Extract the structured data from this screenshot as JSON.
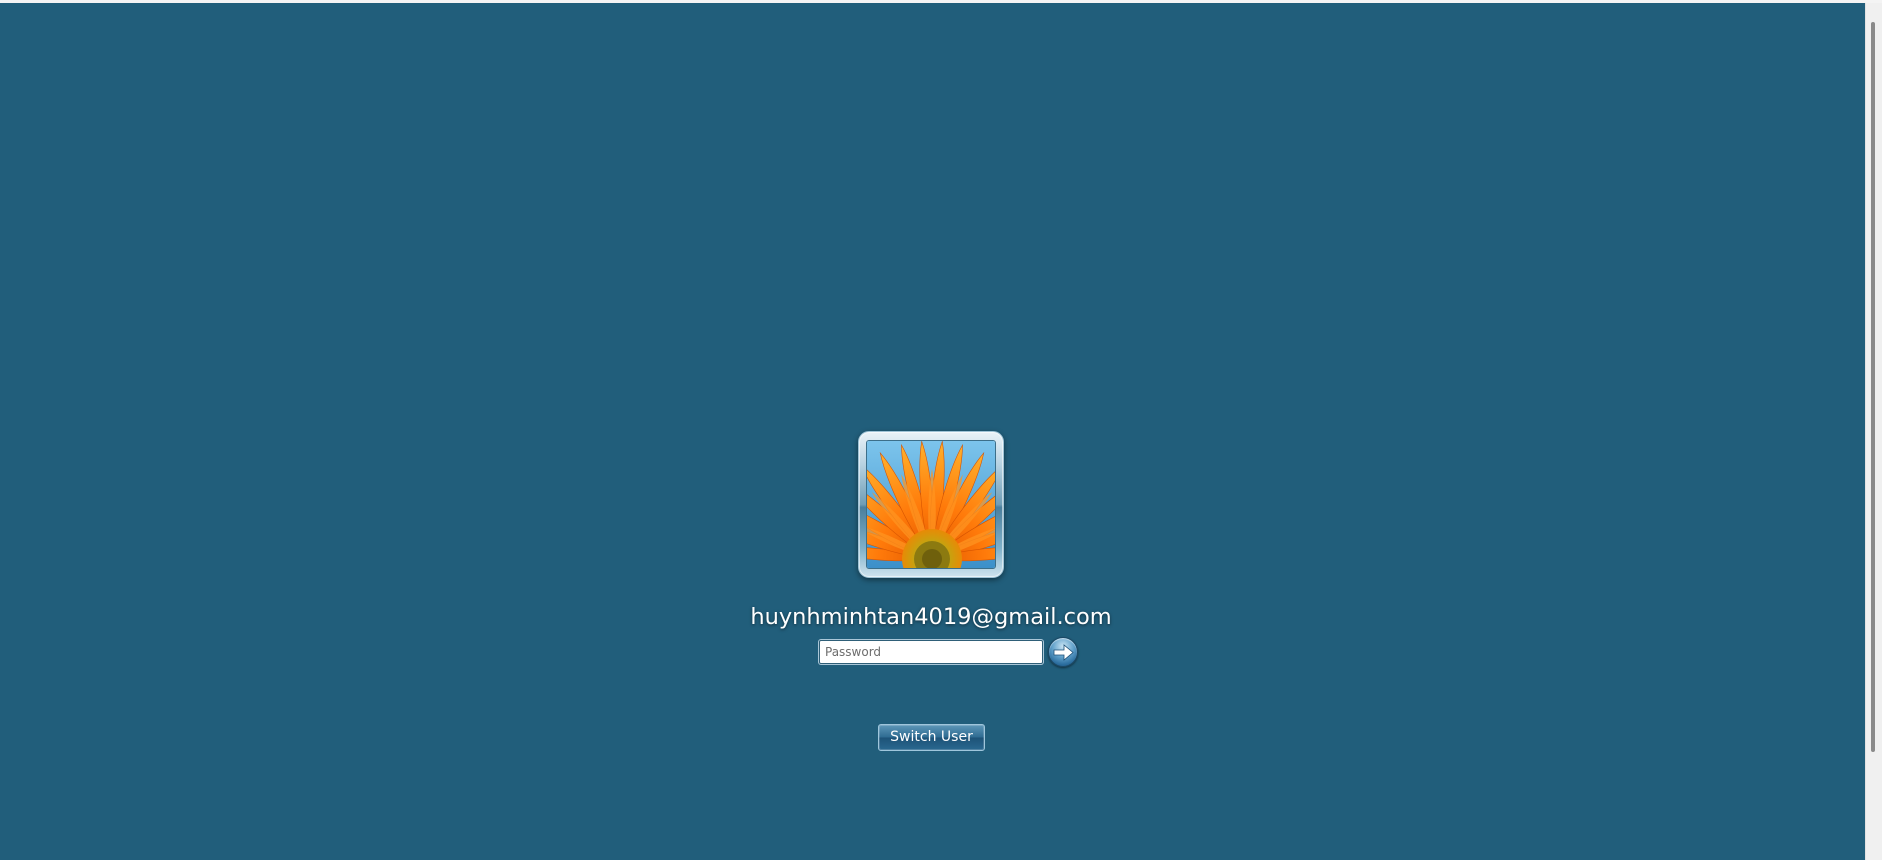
{
  "user": {
    "name": "huynhminhtan4019@gmail.com",
    "picture_icon": "orange-gerbera-flower-user-picture"
  },
  "password": {
    "placeholder": "Password",
    "value": ""
  },
  "submit": {
    "icon": "arrow-right-icon",
    "aria_label": "Submit"
  },
  "switch_user": {
    "label": "Switch User"
  },
  "colors": {
    "background": "#215e7b",
    "text": "#ffffff"
  }
}
